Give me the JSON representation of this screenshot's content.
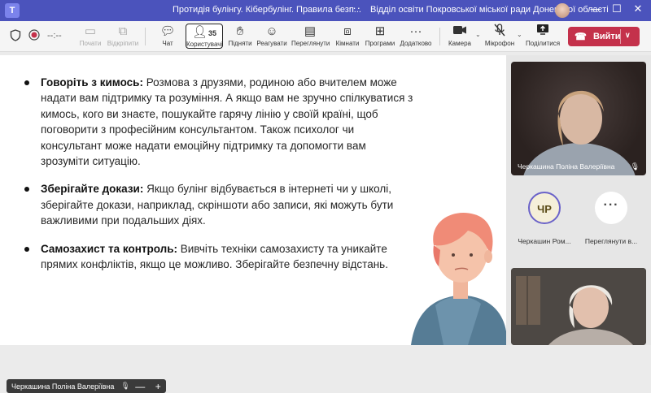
{
  "titlebar": {
    "title": "Протидія булінгу. Кібербулінг. Правила безп...",
    "more": "···",
    "org": "Відділ освіти Покровської міської ради Донецької області",
    "minimize": "—",
    "maximize": "☐",
    "close": "✕"
  },
  "toolbar": {
    "timer": "--:--",
    "tools": {
      "video": "Почати",
      "record": "Відкріпити",
      "chat": "Чат",
      "people": "Користувачі",
      "people_count": "35",
      "raise": "Підняти",
      "react": "Реагувати",
      "view": "Переглянути",
      "rooms": "Кімнати",
      "apps": "Програми",
      "more": "Додатково",
      "camera": "Камера",
      "mic": "Мікрофон",
      "share": "Поділитися"
    },
    "leave_label": "Вийти"
  },
  "slide": {
    "bullets": [
      {
        "bold": "Говоріть з кимось:",
        "text": " Розмова з друзями, родиною або вчителем може надати вам підтримку та розуміння. А якщо вам не зручно спілкуватися з кимось, кого ви знаєте, пошукайте гарячу лінію у своїй країні, щоб поговорити з професійним консультантом. Також психолог чи консультант може надати емоційну підтримку та допомогти вам зрозуміти ситуацію."
      },
      {
        "bold": "Зберігайте докази:",
        "text": " Якщо булінг відбувається в інтернеті чи у школі, зберігайте докази, наприклад, скріншоти або записи, які можуть бути важливими при подальших діях."
      },
      {
        "bold": "Самозахист та контроль:",
        "text": " Вивчіть техніки самозахисту та уникайте прямих конфліктів, якщо це можливо. Зберігайте безпечну відстань."
      }
    ]
  },
  "presenter": {
    "name": "Черкашина Поліна Валеріївна",
    "zoom_minus": "—",
    "zoom_plus": "+"
  },
  "participants": {
    "tile1_name": "Черкашина Поліна Валеріївна",
    "p1_initials": "ЧР",
    "p1_name": "Черкашин Ром...",
    "p2_symbol": "···",
    "p2_name": "Переглянути в..."
  },
  "colors": {
    "titlebar": "#4b53bc",
    "leave": "#c4314b",
    "accent": "#6b63c9"
  }
}
